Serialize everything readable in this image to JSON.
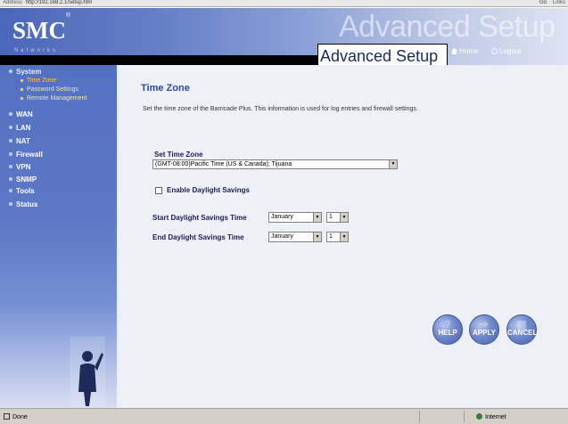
{
  "browser": {
    "address_label": "Address",
    "address": "http://192.168.2.1/setup.htm",
    "go_label": "Go",
    "links_label": "Links"
  },
  "header": {
    "brand": "SMC",
    "brand_mark": "®",
    "brand_sub": "Networks",
    "bg_title": "Advanced Setup",
    "title": "Advanced Setup",
    "home_label": "Home",
    "logout_label": "Logout"
  },
  "sidebar": {
    "items": [
      {
        "label": "System"
      },
      {
        "label": "WAN"
      },
      {
        "label": "LAN"
      },
      {
        "label": "NAT"
      },
      {
        "label": "Firewall"
      },
      {
        "label": "VPN"
      },
      {
        "label": "SNMP"
      },
      {
        "label": "Tools"
      },
      {
        "label": "Status"
      }
    ],
    "sub_items": [
      {
        "label": "Time Zone"
      },
      {
        "label": "Password Settings"
      },
      {
        "label": "Remote Management"
      }
    ]
  },
  "content": {
    "title": "Time Zone",
    "description": "Set the time zone of the Barricade Plus. This information is used for log entries and firewall settings.",
    "set_tz_label": "Set Time Zone",
    "tz_value": "(GMT-08:00)Pacific Time (US & Canada); Tijuana",
    "dls_label": "Enable Daylight Savings",
    "dls_checked": false,
    "start_label": "Start Daylight Savings Time",
    "start_month": "January",
    "start_day": "1",
    "end_label": "End Daylight Savings Time",
    "end_month": "January",
    "end_day": "1"
  },
  "buttons": {
    "help": "HELP",
    "apply": "APPLY",
    "cancel": "CANCEL"
  },
  "status": {
    "left": "Done",
    "zone": "Internet"
  }
}
